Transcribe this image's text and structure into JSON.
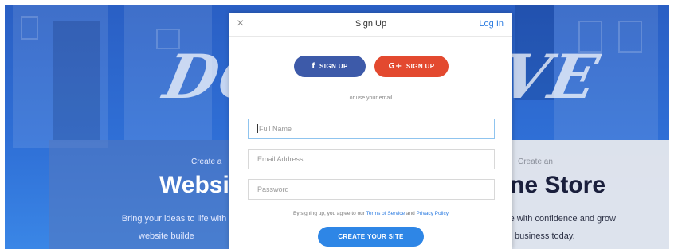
{
  "background": {
    "hero_left_text": "DO",
    "hero_right_text": "VE",
    "left_panel": {
      "kicker": "Create a",
      "title": "Websi",
      "desc_line1": "Bring your ideas to life with our",
      "desc_line2": "website builde"
    },
    "right_panel": {
      "kicker": "Create an",
      "title": "ne Store",
      "desc_line1": "re with confidence and grow",
      "desc_line2": "business today."
    }
  },
  "modal": {
    "close_icon": "close-icon",
    "close_glyph": "×",
    "title": "Sign Up",
    "login_label": "Log In",
    "facebook": {
      "icon": "facebook-icon",
      "glyph": "f",
      "label": "SIGN UP"
    },
    "google": {
      "icon": "google-plus-icon",
      "glyph": "G+",
      "label": "SIGN UP"
    },
    "or_text": "or use your email",
    "fields": {
      "full_name": {
        "placeholder": "Full Name",
        "value": ""
      },
      "email": {
        "placeholder": "Email Address",
        "value": ""
      },
      "password": {
        "placeholder": "Password",
        "value": ""
      }
    },
    "terms": {
      "prefix": "By signing up, you agree to our ",
      "terms_link": "Terms of Service",
      "middle": " and ",
      "privacy_link": "Privacy Policy"
    },
    "create_label": "CREATE YOUR SITE"
  },
  "colors": {
    "accent": "#2e86e6",
    "facebook": "#3d5aa9",
    "google": "#e3492f",
    "link": "#2e7de1",
    "hero_blue": "#2f6fd6"
  }
}
